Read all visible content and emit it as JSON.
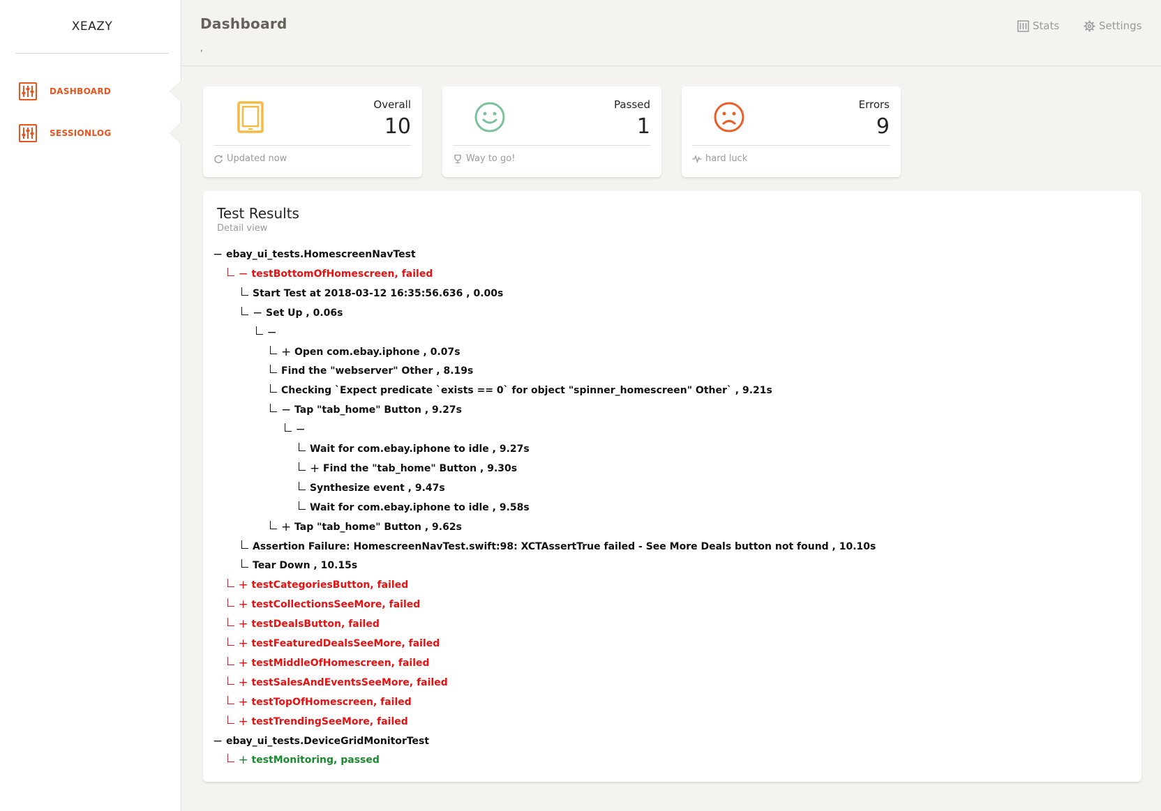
{
  "brand": "XEAZY",
  "nav": [
    {
      "label": "DASHBOARD",
      "icon": "sliders-icon"
    },
    {
      "label": "SESSIONLOG",
      "icon": "sliders-icon"
    }
  ],
  "header": {
    "title": "Dashboard",
    "subtitle": ",",
    "stats_link": "Stats",
    "settings_link": "Settings"
  },
  "stats": [
    {
      "label": "Overall",
      "value": "10",
      "footer": "Updated now",
      "icon": "tablet-icon",
      "color": "#f3bb45"
    },
    {
      "label": "Passed",
      "value": "1",
      "footer": "Way to go!",
      "icon": "smile-icon",
      "color": "#7ac29a"
    },
    {
      "label": "Errors",
      "value": "9",
      "footer": "hard luck",
      "icon": "frown-icon",
      "color": "#eb5e28"
    }
  ],
  "results": {
    "title": "Test Results",
    "subtitle": "Detail view",
    "rows": [
      {
        "level": 0,
        "toggle": "−",
        "elbow": false,
        "text": "ebay_ui_tests.HomescreenNavTest",
        "color": "black"
      },
      {
        "level": 1,
        "toggle": "−",
        "elbow": true,
        "text": "testBottomOfHomescreen, failed",
        "color": "red"
      },
      {
        "level": 2,
        "toggle": "",
        "elbow": true,
        "text": "Start Test at 2018-03-12 16:35:56.636 , 0.00s",
        "color": "black"
      },
      {
        "level": 2,
        "toggle": "−",
        "elbow": true,
        "text": "Set Up , 0.06s",
        "color": "black"
      },
      {
        "level": 3,
        "toggle": "−",
        "elbow": true,
        "text": "",
        "color": "black"
      },
      {
        "level": 4,
        "toggle": "+",
        "elbow": true,
        "text": "Open com.ebay.iphone , 0.07s",
        "color": "black"
      },
      {
        "level": 4,
        "toggle": "",
        "elbow": true,
        "text": "Find the \"webserver\" Other , 8.19s",
        "color": "black"
      },
      {
        "level": 4,
        "toggle": "",
        "elbow": true,
        "text": "Checking `Expect predicate `exists == 0` for object \"spinner_homescreen\" Other` , 9.21s",
        "color": "black"
      },
      {
        "level": 4,
        "toggle": "−",
        "elbow": true,
        "text": "Tap \"tab_home\" Button , 9.27s",
        "color": "black"
      },
      {
        "level": 5,
        "toggle": "−",
        "elbow": true,
        "text": "",
        "color": "black"
      },
      {
        "level": 6,
        "toggle": "",
        "elbow": true,
        "text": "Wait for com.ebay.iphone to idle , 9.27s",
        "color": "black"
      },
      {
        "level": 6,
        "toggle": "+",
        "elbow": true,
        "text": "Find the \"tab_home\" Button , 9.30s",
        "color": "black"
      },
      {
        "level": 6,
        "toggle": "",
        "elbow": true,
        "text": "Synthesize event , 9.47s",
        "color": "black"
      },
      {
        "level": 6,
        "toggle": "",
        "elbow": true,
        "text": "Wait for com.ebay.iphone to idle , 9.58s",
        "color": "black"
      },
      {
        "level": 4,
        "toggle": "+",
        "elbow": true,
        "text": "Tap \"tab_home\" Button , 9.62s",
        "color": "black"
      },
      {
        "level": 2,
        "toggle": "",
        "elbow": true,
        "text": "Assertion Failure: HomescreenNavTest.swift:98: XCTAssertTrue failed - See More Deals button not found , 10.10s",
        "color": "black"
      },
      {
        "level": 2,
        "toggle": "",
        "elbow": true,
        "text": "Tear Down , 10.15s",
        "color": "black"
      },
      {
        "level": 1,
        "toggle": "+",
        "elbow": true,
        "text": "testCategoriesButton, failed",
        "color": "red"
      },
      {
        "level": 1,
        "toggle": "+",
        "elbow": true,
        "text": "testCollectionsSeeMore, failed",
        "color": "red"
      },
      {
        "level": 1,
        "toggle": "+",
        "elbow": true,
        "text": "testDealsButton, failed",
        "color": "red"
      },
      {
        "level": 1,
        "toggle": "+",
        "elbow": true,
        "text": "testFeaturedDealsSeeMore, failed",
        "color": "red"
      },
      {
        "level": 1,
        "toggle": "+",
        "elbow": true,
        "text": "testMiddleOfHomescreen, failed",
        "color": "red"
      },
      {
        "level": 1,
        "toggle": "+",
        "elbow": true,
        "text": "testSalesAndEventsSeeMore, failed",
        "color": "red"
      },
      {
        "level": 1,
        "toggle": "+",
        "elbow": true,
        "text": "testTopOfHomescreen, failed",
        "color": "red"
      },
      {
        "level": 1,
        "toggle": "+",
        "elbow": true,
        "text": "testTrendingSeeMore, failed",
        "color": "red"
      },
      {
        "level": 0,
        "toggle": "−",
        "elbow": false,
        "text": "ebay_ui_tests.DeviceGridMonitorTest",
        "color": "black"
      },
      {
        "level": 1,
        "toggle": "+",
        "elbow": true,
        "text": "testMonitoring, passed",
        "color": "green"
      }
    ]
  }
}
